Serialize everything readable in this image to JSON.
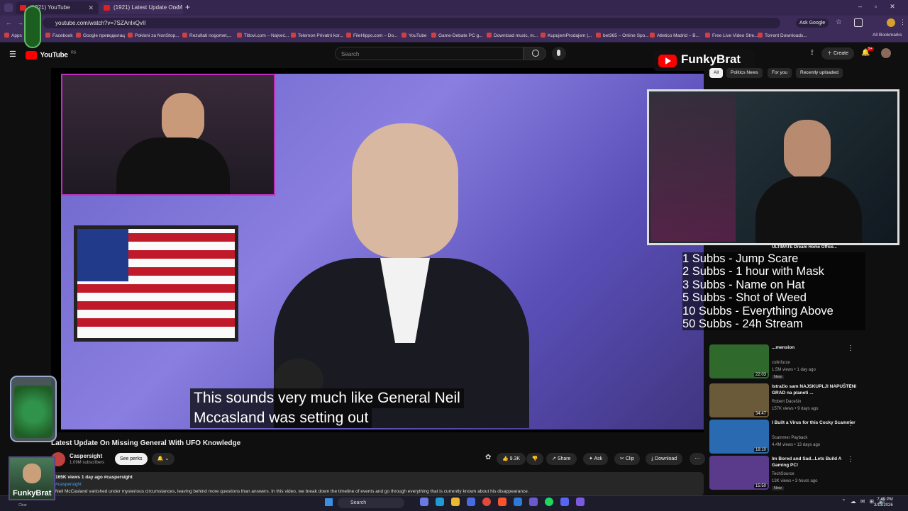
{
  "browser": {
    "tabs": [
      {
        "title": "(1921) YouTube"
      },
      {
        "title": "(1921) Latest Update On M"
      }
    ],
    "url": "youtube.com/watch?v=7SZAnIxQvII",
    "ask_google": "Ask Google",
    "bookmarks": [
      "Apps",
      "Facebook",
      "Google преводилац",
      "Pokloni za NonStop...",
      "Rezultati nogomet,...",
      "Titlovi.com – Najveć...",
      "Telemon Privatni kor...",
      "FileHippo.com – Do...",
      "YouTube",
      "Game-Debate PC g...",
      "Download music, m...",
      "KupujemProdajem |...",
      "bet365 – Online Spo...",
      "Atletico Madrid – B...",
      "Free Live Video Stre...",
      "Torrent Downloads..."
    ],
    "all_bookmarks": "All Bookmarks"
  },
  "youtube": {
    "logo_text": "YouTube",
    "logo_country": "RS",
    "search_placeholder": "Search",
    "create_label": "Create",
    "notif_count": "9+"
  },
  "video": {
    "subtitle_line1": "This sounds very much like General Neil",
    "subtitle_line2": "Mccasland was setting out",
    "title": "Latest Update On Missing General With UFO Knowledge",
    "channel": "Caspersight",
    "subscribers": "1.09M subscribers",
    "perks_label": "See perks",
    "likes": "9.3K",
    "share_label": "Share",
    "ask_label": "Ask",
    "clip_label": "Clip",
    "download_label": "Download",
    "desc_meta": "165K views  1 day ago  #caspersight",
    "desc_tag": "#caspersight",
    "desc_text": "Neil McCasland vanished under mysterious circumstances, leaving behind more questions than answers. In this video, we break down the timeline of events and go through everything that is currently known about his disappearance."
  },
  "overlay": {
    "channel_name": "FunkyBrat",
    "rules": [
      "1 Subbs - Jump Scare",
      "2 Subbs - 1 hour with Mask",
      "3 Subbs - Name on Hat",
      "5 Subbs - Shot of Weed",
      "10 Subbs - Everything Above",
      "50 Subbs - 24h Stream"
    ],
    "corner_label": "FunkyBrat",
    "cam_overlay_text": "ULTIMATE Dream Home Office...",
    "clear_label": "Clear"
  },
  "chips": [
    "All",
    "Politics News",
    "For you",
    "Recently uploaded"
  ],
  "sidebar_videos": [
    {
      "title": "...mension",
      "channel": "colinfurze",
      "meta": "1.5M views • 1 day ago",
      "badge": "New",
      "duration": "22:03",
      "thumb_color": "#2f6a2c"
    },
    {
      "title": "Istražio sam NAJSKUPLJI NAPUŠTENI GRAD na planeti ...",
      "channel": "Robert Dacešin",
      "meta": "157K views • 9 days ago",
      "badge": "",
      "duration": "34:47",
      "thumb_color": "#6a5a3a"
    },
    {
      "title": "I Built a Virus for this Cocky Scammer",
      "channel": "Scammer Payback",
      "meta": "4.4M views • 13 days ago",
      "badge": "",
      "duration": "18:10",
      "thumb_color": "#2a6ab0"
    },
    {
      "title": "Im Bored and Sad...Lets Build A Gaming PC!",
      "channel": "TechSource",
      "meta": "13K views • 3 hours ago",
      "badge": "New",
      "duration": "15:50",
      "thumb_color": "#5a3a8a"
    }
  ],
  "taskbar": {
    "search_label": "Search",
    "time": "7:49 PM",
    "date": "3/13/2026"
  },
  "colors": {
    "browser_tabs": "#35264f",
    "youtube_red": "#ff0000",
    "background": "#0f0f0f",
    "link_blue": "#3ea6ff"
  }
}
